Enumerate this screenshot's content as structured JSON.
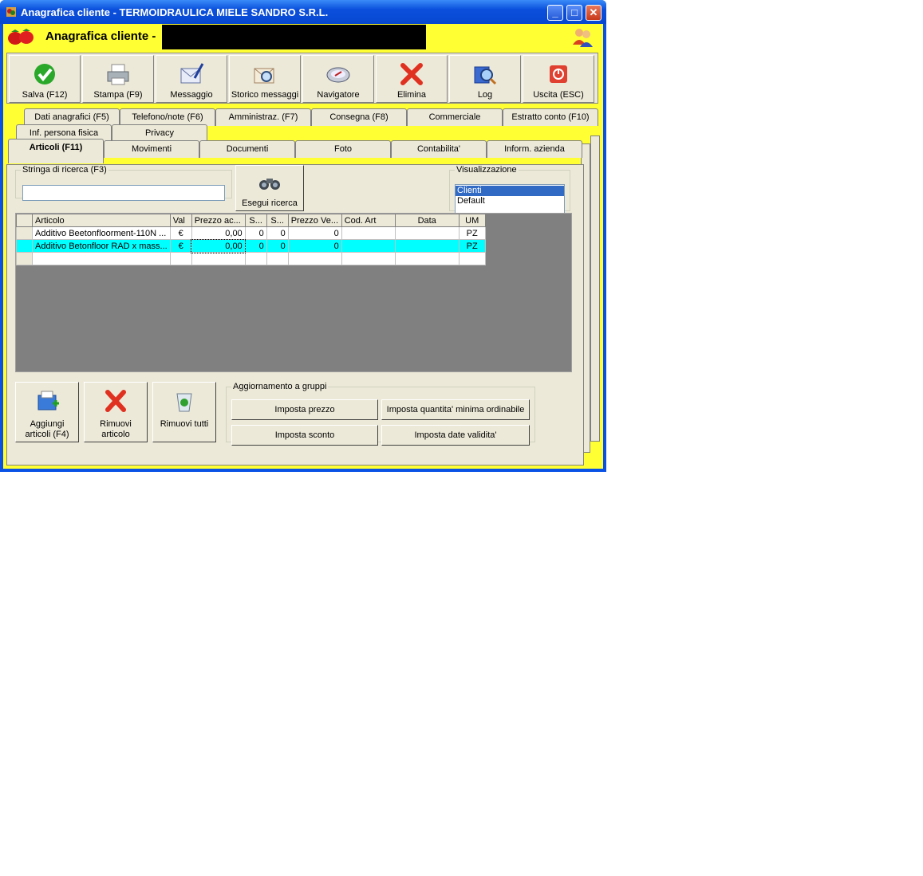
{
  "window": {
    "title": "Anagrafica cliente - TERMOIDRAULICA MIELE SANDRO S.R.L.",
    "min": "_",
    "max": "□",
    "close": "✕"
  },
  "header": {
    "title": "Anagrafica cliente -"
  },
  "toolbar": [
    {
      "label": "Salva (F12)",
      "icon": "check-icon"
    },
    {
      "label": "Stampa (F9)",
      "icon": "printer-icon"
    },
    {
      "label": "Messaggio",
      "icon": "mail-pen-icon"
    },
    {
      "label": "Storico messaggi",
      "icon": "mail-search-icon"
    },
    {
      "label": "Navigatore",
      "icon": "compass-icon"
    },
    {
      "label": "Elimina",
      "icon": "delete-x-icon"
    },
    {
      "label": "Log",
      "icon": "log-search-icon"
    },
    {
      "label": "Uscita (ESC)",
      "icon": "power-icon"
    }
  ],
  "tabs_row1": [
    "Dati anagrafici (F5)",
    "Telefono/note (F6)",
    "Amministraz. (F7)",
    "Consegna (F8)",
    "Commerciale",
    "Estratto conto (F10)"
  ],
  "tabs_row2": [
    "Inf. persona fisica",
    "Privacy"
  ],
  "tabs_row3": [
    "Articoli (F11)",
    "Movimenti",
    "Documenti",
    "Foto",
    "Contabilita'",
    "Inform. azienda"
  ],
  "search": {
    "legend": "Stringa di ricerca (F3)",
    "value": "",
    "button": "Esegui ricerca"
  },
  "view": {
    "legend": "Visualizzazione",
    "options": [
      "Clienti",
      "Default"
    ],
    "selected": "Clienti"
  },
  "table": {
    "columns": [
      "Articolo",
      "Val",
      "Prezzo ac...",
      "S...",
      "S...",
      "Prezzo Ve...",
      "Cod. Art",
      "Data",
      "UM"
    ],
    "rows": [
      [
        "Additivo Beetonfloorment-110N ...",
        "€",
        "0,00",
        "0",
        "0",
        "0",
        "",
        "",
        "PZ"
      ],
      [
        "Additivo Betonfloor RAD x mass...",
        "€",
        "0,00",
        "0",
        "0",
        "0",
        "",
        "",
        "PZ"
      ],
      [
        "",
        "",
        "",
        "",
        "",
        "",
        "",
        "",
        ""
      ]
    ],
    "selected_row": 1
  },
  "bottom_buttons": [
    {
      "label1": "Aggiungi",
      "label2": "articoli (F4)",
      "icon": "add-items-icon"
    },
    {
      "label1": "Rimuovi",
      "label2": "articolo",
      "icon": "remove-x-icon"
    },
    {
      "label1": "",
      "label2": "Rimuovi tutti",
      "icon": "recycle-bin-icon"
    }
  ],
  "group_update": {
    "legend": "Aggiornamento a gruppi",
    "buttons": [
      "Imposta prezzo",
      "Imposta quantita' minima ordinabile",
      "Imposta sconto",
      "Imposta date validita'"
    ]
  },
  "colors": {
    "title_bar": "#0a52e6",
    "client_bg": "#ffff33",
    "selected_row": "#00ffff",
    "panel": "#ece9d8"
  }
}
